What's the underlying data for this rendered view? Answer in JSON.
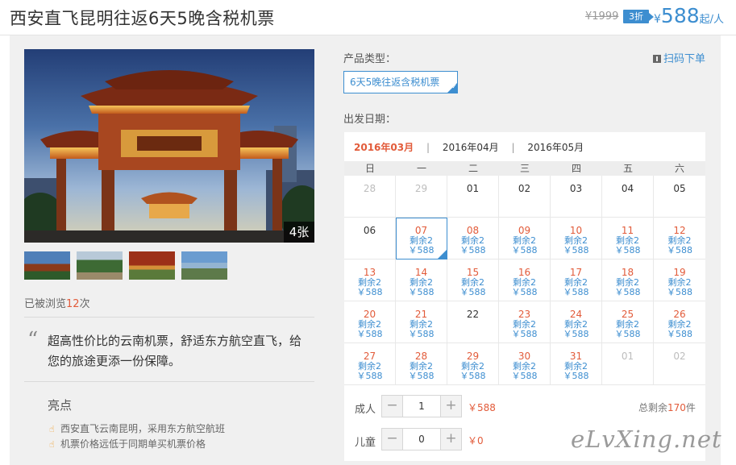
{
  "header": {
    "title": "西安直飞昆明往返6天5晚含税机票",
    "original_price": "¥1999",
    "discount_badge": "3折",
    "price_currency": "¥",
    "price_value": "588",
    "price_unit": "起/人"
  },
  "gallery": {
    "photo_count_label": "4张",
    "thumbnails": [
      "thumb-1",
      "thumb-2",
      "thumb-3",
      "thumb-4"
    ]
  },
  "views": {
    "prefix": "已被浏览",
    "count": "12",
    "suffix": "次"
  },
  "description": "超高性价比的云南机票，舒适东方航空直飞，给您的旅途更添一份保障。",
  "highlights": {
    "title": "亮点",
    "items": [
      "西安直飞云南昆明，采用东方航空航班",
      "机票价格远低于同期单买机票价格"
    ]
  },
  "product": {
    "type_label": "产品类型：",
    "type_option": "6天5晚往返含税机票",
    "scan_label": "扫码下单"
  },
  "calendar": {
    "date_label": "出发日期：",
    "months": [
      "2016年03月",
      "2016年04月",
      "2016年05月"
    ],
    "active_month": "2016年03月",
    "weekdays": [
      "日",
      "一",
      "二",
      "三",
      "四",
      "五",
      "六"
    ],
    "stock_label": "剩余2",
    "price_label": "￥588",
    "weeks": [
      [
        {
          "d": "28",
          "s": "gray"
        },
        {
          "d": "29",
          "s": "gray"
        },
        {
          "d": "01",
          "s": "plain"
        },
        {
          "d": "02",
          "s": "plain"
        },
        {
          "d": "03",
          "s": "plain"
        },
        {
          "d": "04",
          "s": "plain"
        },
        {
          "d": "05",
          "s": "plain"
        }
      ],
      [
        {
          "d": "06",
          "s": "plain"
        },
        {
          "d": "07",
          "s": "avail",
          "sel": true
        },
        {
          "d": "08",
          "s": "avail"
        },
        {
          "d": "09",
          "s": "avail"
        },
        {
          "d": "10",
          "s": "avail"
        },
        {
          "d": "11",
          "s": "avail"
        },
        {
          "d": "12",
          "s": "avail"
        }
      ],
      [
        {
          "d": "13",
          "s": "avail"
        },
        {
          "d": "14",
          "s": "avail"
        },
        {
          "d": "15",
          "s": "avail"
        },
        {
          "d": "16",
          "s": "avail"
        },
        {
          "d": "17",
          "s": "avail"
        },
        {
          "d": "18",
          "s": "avail"
        },
        {
          "d": "19",
          "s": "avail"
        }
      ],
      [
        {
          "d": "20",
          "s": "avail"
        },
        {
          "d": "21",
          "s": "avail"
        },
        {
          "d": "22",
          "s": "plain"
        },
        {
          "d": "23",
          "s": "avail"
        },
        {
          "d": "24",
          "s": "avail"
        },
        {
          "d": "25",
          "s": "avail"
        },
        {
          "d": "26",
          "s": "avail"
        }
      ],
      [
        {
          "d": "27",
          "s": "avail"
        },
        {
          "d": "28",
          "s": "avail"
        },
        {
          "d": "29",
          "s": "avail"
        },
        {
          "d": "30",
          "s": "avail"
        },
        {
          "d": "31",
          "s": "avail"
        },
        {
          "d": "01",
          "s": "gray"
        },
        {
          "d": "02",
          "s": "gray"
        }
      ]
    ]
  },
  "booking": {
    "adult_label": "成人",
    "adult_qty": "1",
    "adult_price": "￥588",
    "child_label": "儿童",
    "child_qty": "0",
    "child_price": "￥0",
    "minus_symbol": "−",
    "plus_symbol": "+",
    "remaining_prefix": "总剩余",
    "remaining_count": "170",
    "remaining_suffix": "件"
  },
  "watermark": "eLvXing.net",
  "colors": {
    "accent": "#3d8ed0",
    "highlight": "#e25b3a"
  }
}
